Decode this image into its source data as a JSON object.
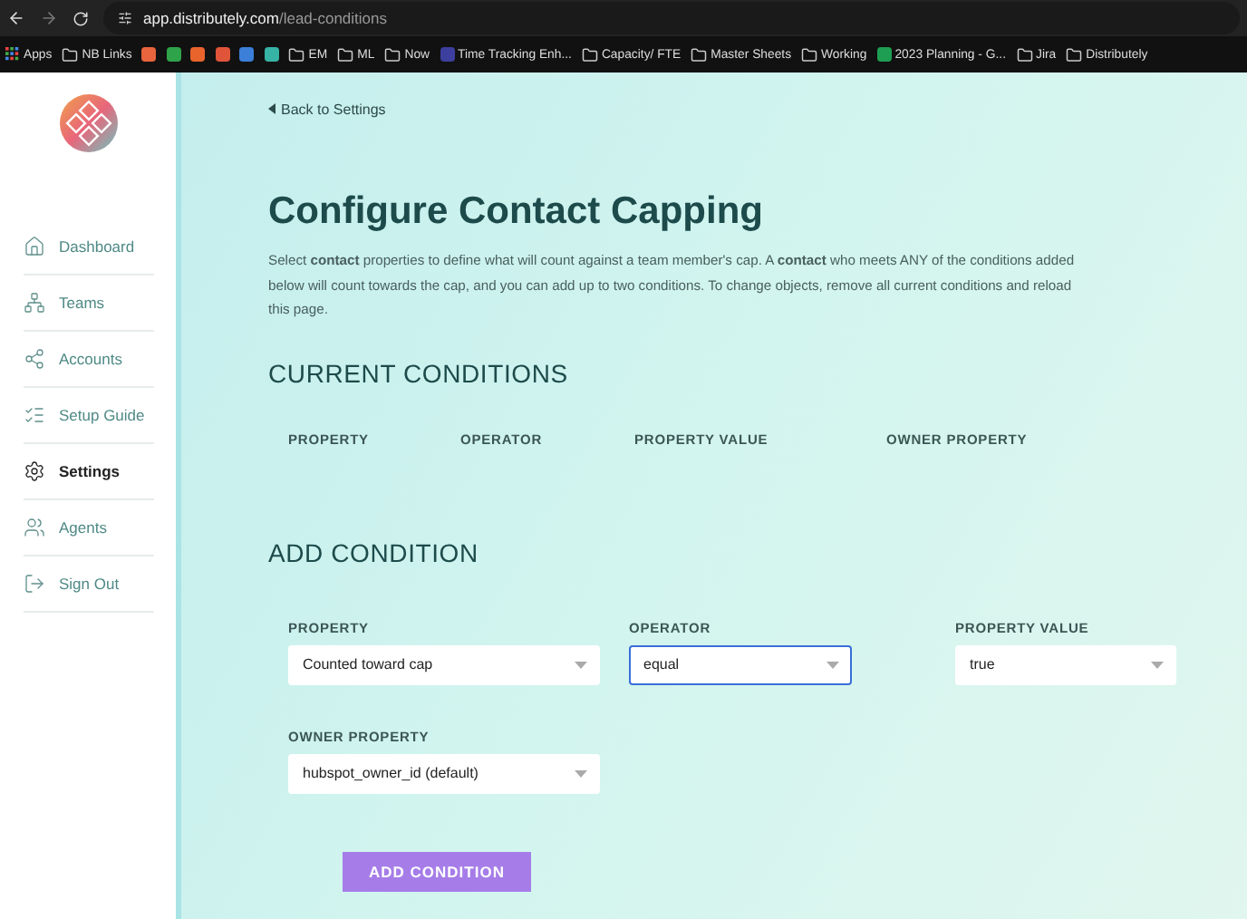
{
  "browser": {
    "url_host": "app.distributely.com",
    "url_path": "/lead-conditions",
    "bookmarks": [
      {
        "kind": "apps",
        "label": "Apps"
      },
      {
        "kind": "folder",
        "label": "NB Links"
      },
      {
        "kind": "site",
        "color": "#e8643c"
      },
      {
        "kind": "site",
        "color": "#2fa34a"
      },
      {
        "kind": "site",
        "color": "#e8642c"
      },
      {
        "kind": "site",
        "color": "#e0553a"
      },
      {
        "kind": "site",
        "color": "#3b7fd9"
      },
      {
        "kind": "site",
        "color": "#37b3a5"
      },
      {
        "kind": "folder",
        "label": "EM"
      },
      {
        "kind": "folder",
        "label": "ML"
      },
      {
        "kind": "folder",
        "label": "Now"
      },
      {
        "kind": "site",
        "color": "#3d3f9e",
        "label": "Time Tracking Enh..."
      },
      {
        "kind": "folder",
        "label": "Capacity/ FTE"
      },
      {
        "kind": "folder",
        "label": "Master Sheets"
      },
      {
        "kind": "folder",
        "label": "Working"
      },
      {
        "kind": "site",
        "color": "#1e9e52",
        "label": "2023 Planning - G..."
      },
      {
        "kind": "folder",
        "label": "Jira"
      },
      {
        "kind": "folder",
        "label": "Distributely"
      }
    ]
  },
  "sidebar": {
    "items": [
      {
        "label": "Dashboard",
        "selected": false
      },
      {
        "label": "Teams",
        "selected": false
      },
      {
        "label": "Accounts",
        "selected": false
      },
      {
        "label": "Setup Guide",
        "selected": false
      },
      {
        "label": "Settings",
        "selected": true
      },
      {
        "label": "Agents",
        "selected": false
      },
      {
        "label": "Sign Out",
        "selected": false
      }
    ]
  },
  "back_link": "Back to Settings",
  "title": "Configure Contact Capping",
  "description": "Select **contact** properties to define what will count against a team member's cap. A **contact** who meets ANY of the conditions added below will count towards the cap, and you can add up to two conditions. To change objects, remove all current conditions and reload this page.",
  "current_conditions": {
    "heading": "CURRENT CONDITIONS",
    "columns": [
      "PROPERTY",
      "OPERATOR",
      "PROPERTY VALUE",
      "OWNER PROPERTY"
    ]
  },
  "add_condition": {
    "heading": "ADD CONDITION",
    "fields": [
      {
        "label": "PROPERTY",
        "value": "Counted toward cap",
        "focused": false
      },
      {
        "label": "OPERATOR",
        "value": "equal",
        "focused": true
      },
      {
        "label": "PROPERTY VALUE",
        "value": "true",
        "focused": false
      },
      {
        "label": "OWNER PROPERTY",
        "value": "hubspot_owner_id (default)",
        "focused": false
      }
    ],
    "button": "ADD CONDITION"
  }
}
